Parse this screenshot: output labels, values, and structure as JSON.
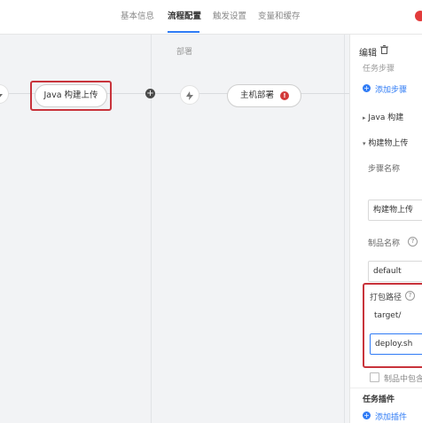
{
  "tabs": [
    {
      "label": "基本信息",
      "active": false
    },
    {
      "label": "流程配置",
      "active": true
    },
    {
      "label": "触发设置",
      "active": false
    },
    {
      "label": "变量和缓存",
      "active": false
    }
  ],
  "canvas": {
    "stage_label": "部署",
    "nodes": {
      "java_upload": "Java 构建上传",
      "host_deploy": "主机部署"
    },
    "host_deploy_badge": "!"
  },
  "panel": {
    "header": "编辑",
    "section_steps": "任务步骤",
    "add_step": "添加步骤",
    "step_java_build": "Java 构建",
    "step_upload": "构建物上传",
    "step_name_label": "步骤名称",
    "step_name_value": "构建物上传",
    "artifact_name_label": "制品名称",
    "artifact_name_value": "default",
    "pack_path_label": "打包路径",
    "pack_path_value": "target/",
    "pack_path_value2": "deploy.sh",
    "include_checkbox_label": "制品中包含",
    "section_plugins": "任务插件",
    "add_plugin": "添加插件"
  },
  "colors": {
    "accent": "#2f7bf5",
    "highlight": "#c8333b",
    "error": "#d23a3a"
  }
}
